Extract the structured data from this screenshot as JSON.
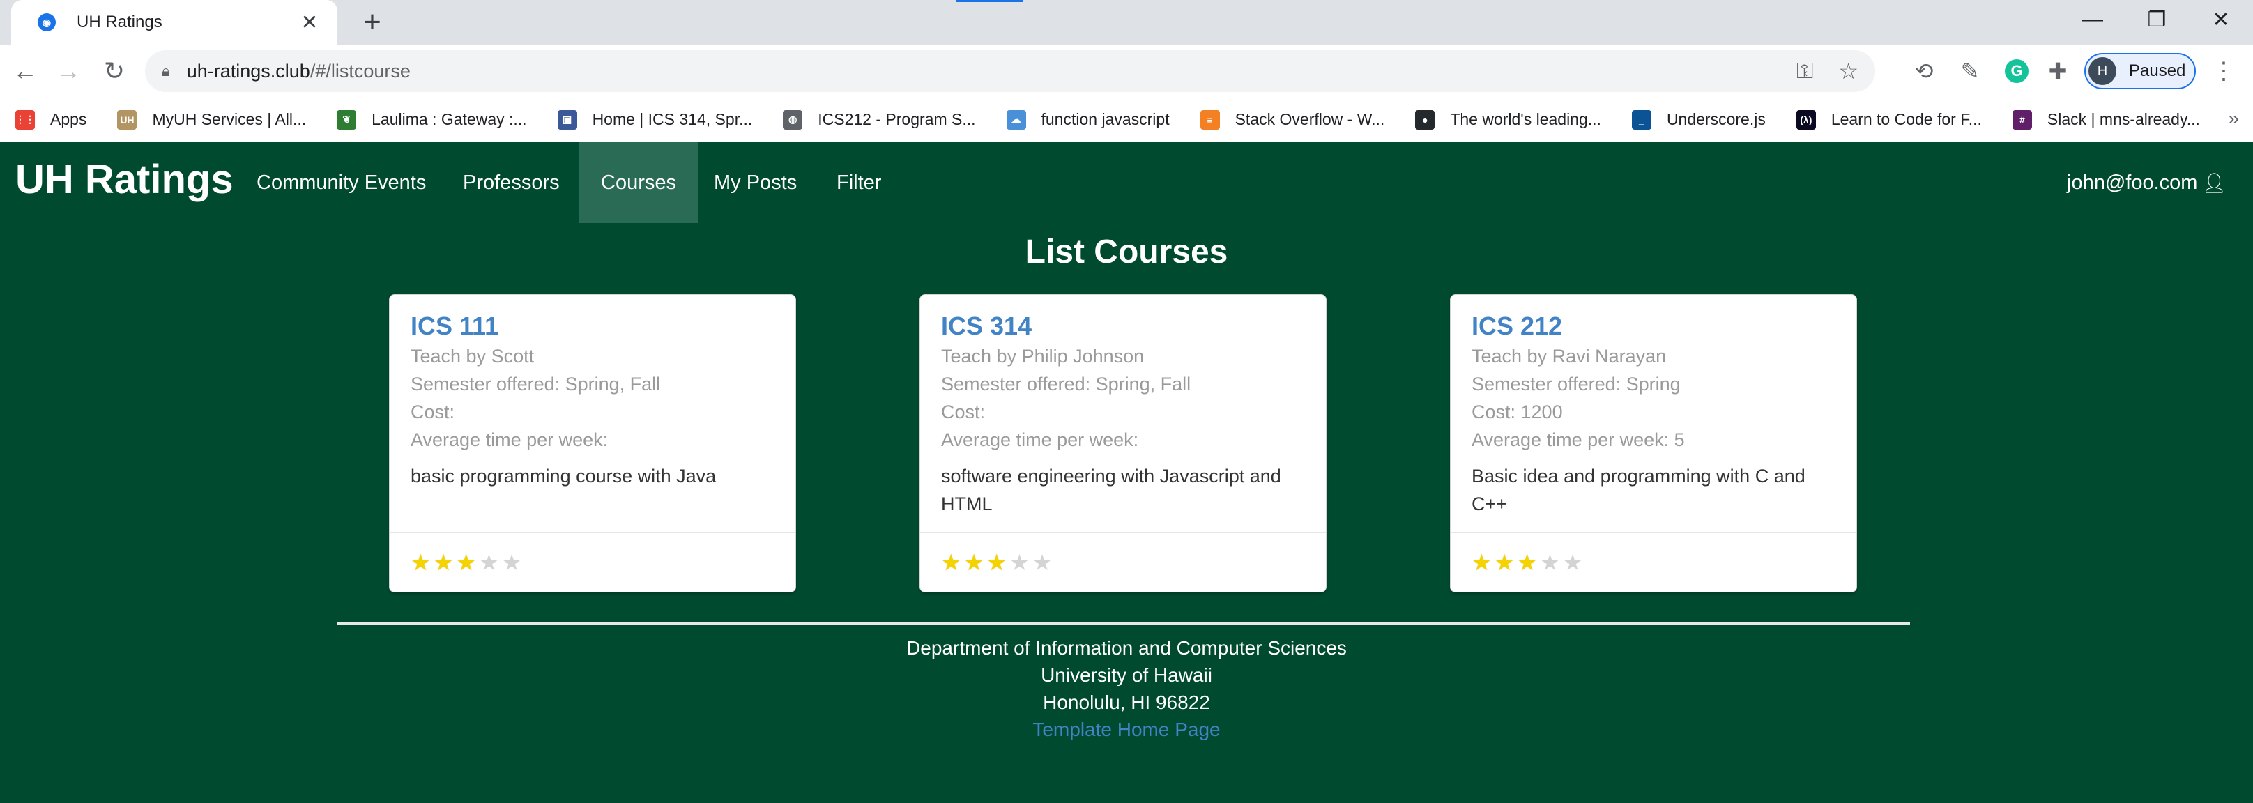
{
  "browser": {
    "tab_title": "UH Ratings",
    "tab_close": "✕",
    "new_tab": "+",
    "window_controls": {
      "minimize": "—",
      "restore": "❐",
      "close": "✕"
    },
    "nav": {
      "back": "←",
      "forward": "→",
      "reload": "↻"
    },
    "url_host": "uh-ratings.club",
    "url_path": "/#/listcourse",
    "profile_initial": "H",
    "profile_status": "Paused",
    "menu": "⋮"
  },
  "bookmarks": {
    "items": [
      {
        "label": "Apps",
        "icon": "apps-grid-icon",
        "color": "#ea4335"
      },
      {
        "label": "MyUH Services | All...",
        "icon": "uh-icon",
        "color": "#b39563"
      },
      {
        "label": "Laulima : Gateway :...",
        "icon": "leaf-icon",
        "color": "#2e7d32"
      },
      {
        "label": "Home | ICS 314, Spr...",
        "icon": "page-icon",
        "color": "#3b5998"
      },
      {
        "label": "ICS212 - Program S...",
        "icon": "globe-icon",
        "color": "#5f6368"
      },
      {
        "label": "function javascript",
        "icon": "cloud-icon",
        "color": "#4a90d9"
      },
      {
        "label": "Stack Overflow - W...",
        "icon": "stackoverflow-icon",
        "color": "#f48024"
      },
      {
        "label": "The world's leading...",
        "icon": "github-icon",
        "color": "#24292e"
      },
      {
        "label": "Underscore.js",
        "icon": "underscore-icon",
        "color": "#0b5394"
      },
      {
        "label": "Learn to Code for F...",
        "icon": "freecodecamp-icon",
        "color": "#0a0a23"
      },
      {
        "label": "Slack | mns-already...",
        "icon": "slack-icon",
        "color": "#611f69"
      }
    ],
    "more": "»"
  },
  "site": {
    "brand": "UH Ratings",
    "nav": [
      "Community Events",
      "Professors",
      "Courses",
      "My Posts",
      "Filter"
    ],
    "active_nav": "Courses",
    "user": "john@foo.com",
    "accent": "#004a30"
  },
  "page": {
    "title": "List Courses",
    "courses": [
      {
        "title": "ICS 111",
        "teacher": "Teach by Scott",
        "semester": "Semester offered: Spring, Fall",
        "cost": "Cost:",
        "time": "Average time per week:",
        "description": "basic programming course with Java",
        "rating": 3,
        "max_rating": 5
      },
      {
        "title": "ICS 314",
        "teacher": "Teach by Philip Johnson",
        "semester": "Semester offered: Spring, Fall",
        "cost": "Cost:",
        "time": "Average time per week:",
        "description": "software engineering with Javascript and HTML",
        "rating": 3,
        "max_rating": 5
      },
      {
        "title": "ICS 212",
        "teacher": "Teach by Ravi Narayan",
        "semester": "Semester offered: Spring",
        "cost": "Cost: 1200",
        "time": "Average time per week: 5",
        "description": "Basic idea and programming with C and C++",
        "rating": 3,
        "max_rating": 5
      }
    ]
  },
  "footer": {
    "line1": "Department of Information and Computer Sciences",
    "line2": "University of Hawaii",
    "line3": "Honolulu, HI 96822",
    "link": "Template Home Page"
  }
}
